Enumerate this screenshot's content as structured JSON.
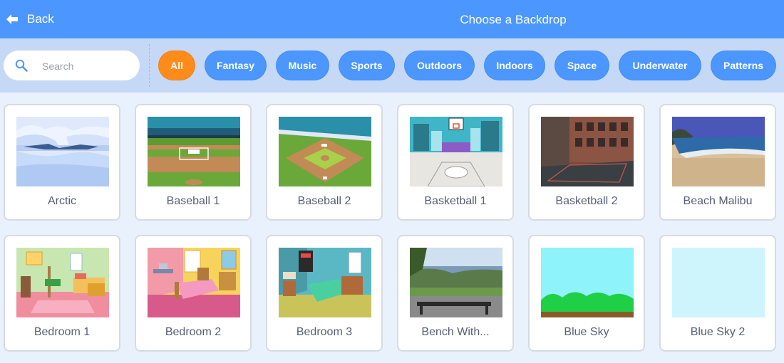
{
  "header": {
    "back_label": "Back",
    "title": "Choose a Backdrop"
  },
  "search": {
    "placeholder": "Search",
    "value": ""
  },
  "tags": [
    {
      "label": "All",
      "active": true
    },
    {
      "label": "Fantasy",
      "active": false
    },
    {
      "label": "Music",
      "active": false
    },
    {
      "label": "Sports",
      "active": false
    },
    {
      "label": "Outdoors",
      "active": false
    },
    {
      "label": "Indoors",
      "active": false
    },
    {
      "label": "Space",
      "active": false
    },
    {
      "label": "Underwater",
      "active": false
    },
    {
      "label": "Patterns",
      "active": false
    }
  ],
  "colors": {
    "header": "#4c97ff",
    "active_tag": "#ff8c1a",
    "tag": "#4c97ff",
    "filter_bar": "#c5d9f6",
    "text": "#575e75"
  },
  "backdrops": [
    {
      "name": "Arctic"
    },
    {
      "name": "Baseball 1"
    },
    {
      "name": "Baseball 2"
    },
    {
      "name": "Basketball 1"
    },
    {
      "name": "Basketball 2"
    },
    {
      "name": "Beach Malibu"
    },
    {
      "name": "Bedroom 1"
    },
    {
      "name": "Bedroom 2"
    },
    {
      "name": "Bedroom 3"
    },
    {
      "name": "Bench With..."
    },
    {
      "name": "Blue Sky"
    },
    {
      "name": "Blue Sky 2"
    }
  ]
}
